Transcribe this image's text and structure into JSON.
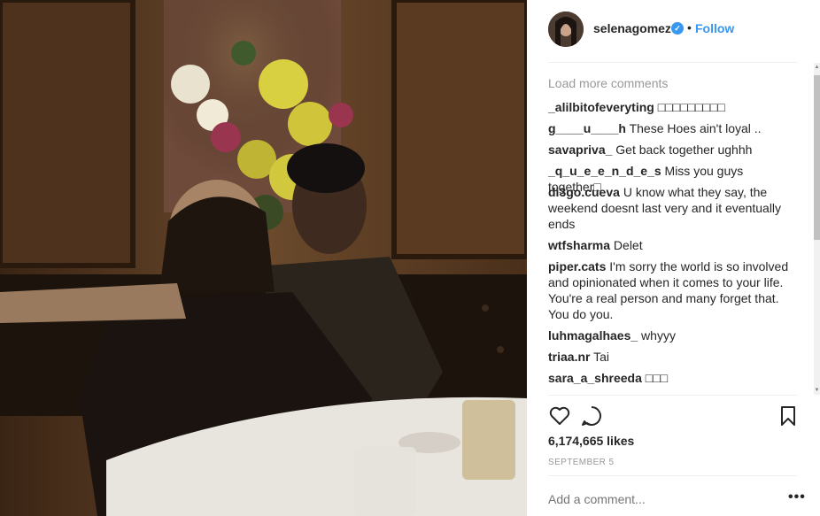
{
  "post": {
    "username": "selenagomez",
    "verified_icon": "check-icon",
    "separator": "•",
    "follow_label": "Follow",
    "load_more": "Load more comments",
    "comments": [
      {
        "user": "_alilbitofeveryting",
        "text": "□□□□□□□□□"
      },
      {
        "user": "g____u____h",
        "text": "These Hoes ain't loyal .."
      },
      {
        "user": "savapriva_",
        "text": "Get back together ughhh"
      },
      {
        "user": "_q_u_e_e_n_d_e_s",
        "text": "Miss you guys together□"
      },
      {
        "user": "di3go.cueva",
        "text": "U know what they say, the weekend doesnt last very and it eventually ends"
      },
      {
        "user": "wtfsharma",
        "text": "Delet"
      },
      {
        "user": "piper.cats",
        "text": "I'm sorry the world is so involved and opinionated when it comes to your life. You're a real person and many forget that. You do you."
      },
      {
        "user": "luhmagalhaes_",
        "text": "whyyy"
      },
      {
        "user": "triaa.nr",
        "text": "Tai"
      },
      {
        "user": "sara_a_shreeda",
        "text": "□□□"
      }
    ],
    "likes": "6,174,665 likes",
    "date": "SEPTEMBER 5",
    "add_comment_placeholder": "Add a comment...",
    "more_label": "•••"
  },
  "colors": {
    "link_blue": "#3897f0",
    "muted": "#999999",
    "text": "#262626"
  }
}
